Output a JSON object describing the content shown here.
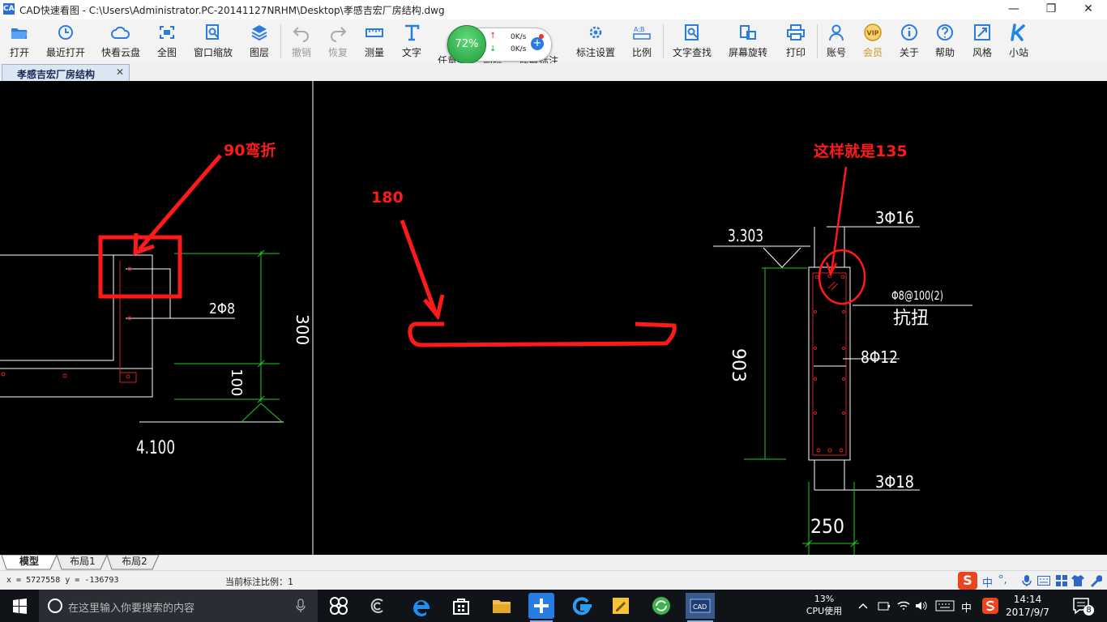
{
  "window": {
    "title": "CAD快速看图 - C:\\Users\\Administrator.PC-20141127NRHM\\Desktop\\孝感吉宏厂房结构.dwg",
    "app_icon_text": "CAD",
    "minimize": "—",
    "restore": "❐",
    "close": "✕"
  },
  "toolbar": {
    "open": "打开",
    "recent": "最近打开",
    "cloud": "快看云盘",
    "fit_all": "全图",
    "window_zoom": "窗口缩放",
    "layers": "图层",
    "undo": "撤销",
    "redo": "恢复",
    "measure": "测量",
    "text": "文字",
    "polyline": "任意线",
    "delete": "删除",
    "hide_annotation": "隐藏标注",
    "annotation_settings": "标注设置",
    "scale": "比例",
    "text_search": "文字查找",
    "screen_rotate": "屏幕旋转",
    "print": "打印",
    "account": "账号",
    "member": "会员",
    "about": "关于",
    "help": "帮助",
    "style": "风格",
    "station": "小站"
  },
  "net_widget": {
    "percent": "72%",
    "up_speed": "0K/s",
    "down_speed": "0K/s",
    "up_arrow": "↑",
    "down_arrow": "↓",
    "plus": "+"
  },
  "document_tab": {
    "title": "孝感吉宏厂房结构",
    "close": "✕"
  },
  "drawing": {
    "annotations": {
      "bend90": "90弯折",
      "hook180": "180",
      "hook135": "这样就是135"
    },
    "labels": {
      "rebar_2phi8": "2Φ8",
      "dim_300": "300",
      "dim_100": "100",
      "elev_4100": "4.100",
      "elev_3303": "3.303",
      "top_bars": "3Φ16",
      "stirrup": "Φ8@100(2)",
      "torsion": "抗扭",
      "side_bars": "8Φ12",
      "dim_903": "903",
      "bottom_bars": "3Φ18",
      "dim_250": "250"
    },
    "colors": {
      "background": "#000000",
      "line_white": "#ffffff",
      "line_green": "#22cc22",
      "line_red": "#d22222",
      "annotation_red": "#ff1a1a"
    }
  },
  "layout_tabs": [
    "模型",
    "布局1",
    "布局2"
  ],
  "status": {
    "coords": "x = 5727558  y = -136793",
    "scale_label": "当前标注比例：1"
  },
  "ime": {
    "logo": "S",
    "lang": "中",
    "punct": "°,"
  },
  "taskbar": {
    "search_placeholder": "在这里输入你要搜索的内容",
    "cpu_percent": "13%",
    "cpu_label": "CPU使用",
    "ime_lang": "中",
    "time": "14:14",
    "date": "2017/9/7",
    "notifications": "8"
  }
}
